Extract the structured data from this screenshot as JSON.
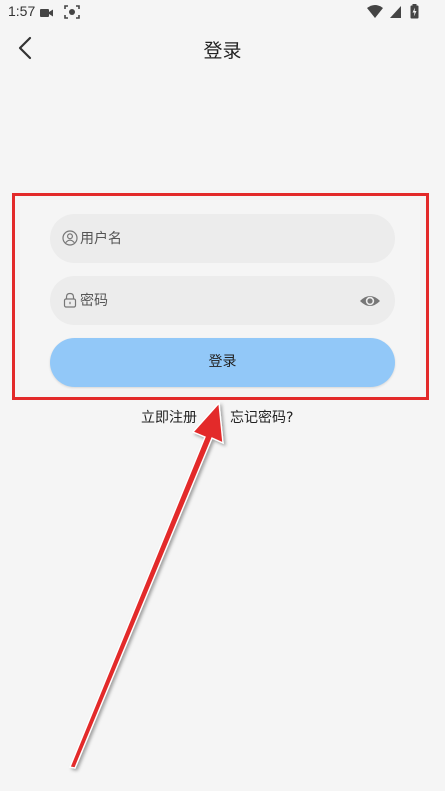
{
  "status_bar": {
    "time": "1:57",
    "left_icons": [
      "video-camera-icon",
      "screen-record-icon"
    ],
    "right_icons": [
      "wifi-icon",
      "cellular-signal-icon",
      "battery-charging-icon"
    ]
  },
  "header": {
    "title": "登录",
    "back_icon": "chevron-left-icon"
  },
  "form": {
    "username": {
      "placeholder": "用户名",
      "value": "",
      "icon": "user-icon"
    },
    "password": {
      "placeholder": "密码",
      "value": "",
      "icon": "lock-icon",
      "toggle_icon": "eye-icon"
    },
    "login_button_label": "登录"
  },
  "links": {
    "register": "立即注册",
    "forgot_password": "忘记密码?"
  },
  "annotation": {
    "highlight_color": "#e32a2a",
    "arrow_color": "#e32a2a"
  },
  "colors": {
    "background": "#f5f5f5",
    "field_background": "#ececec",
    "button_background": "#92c8f8"
  }
}
